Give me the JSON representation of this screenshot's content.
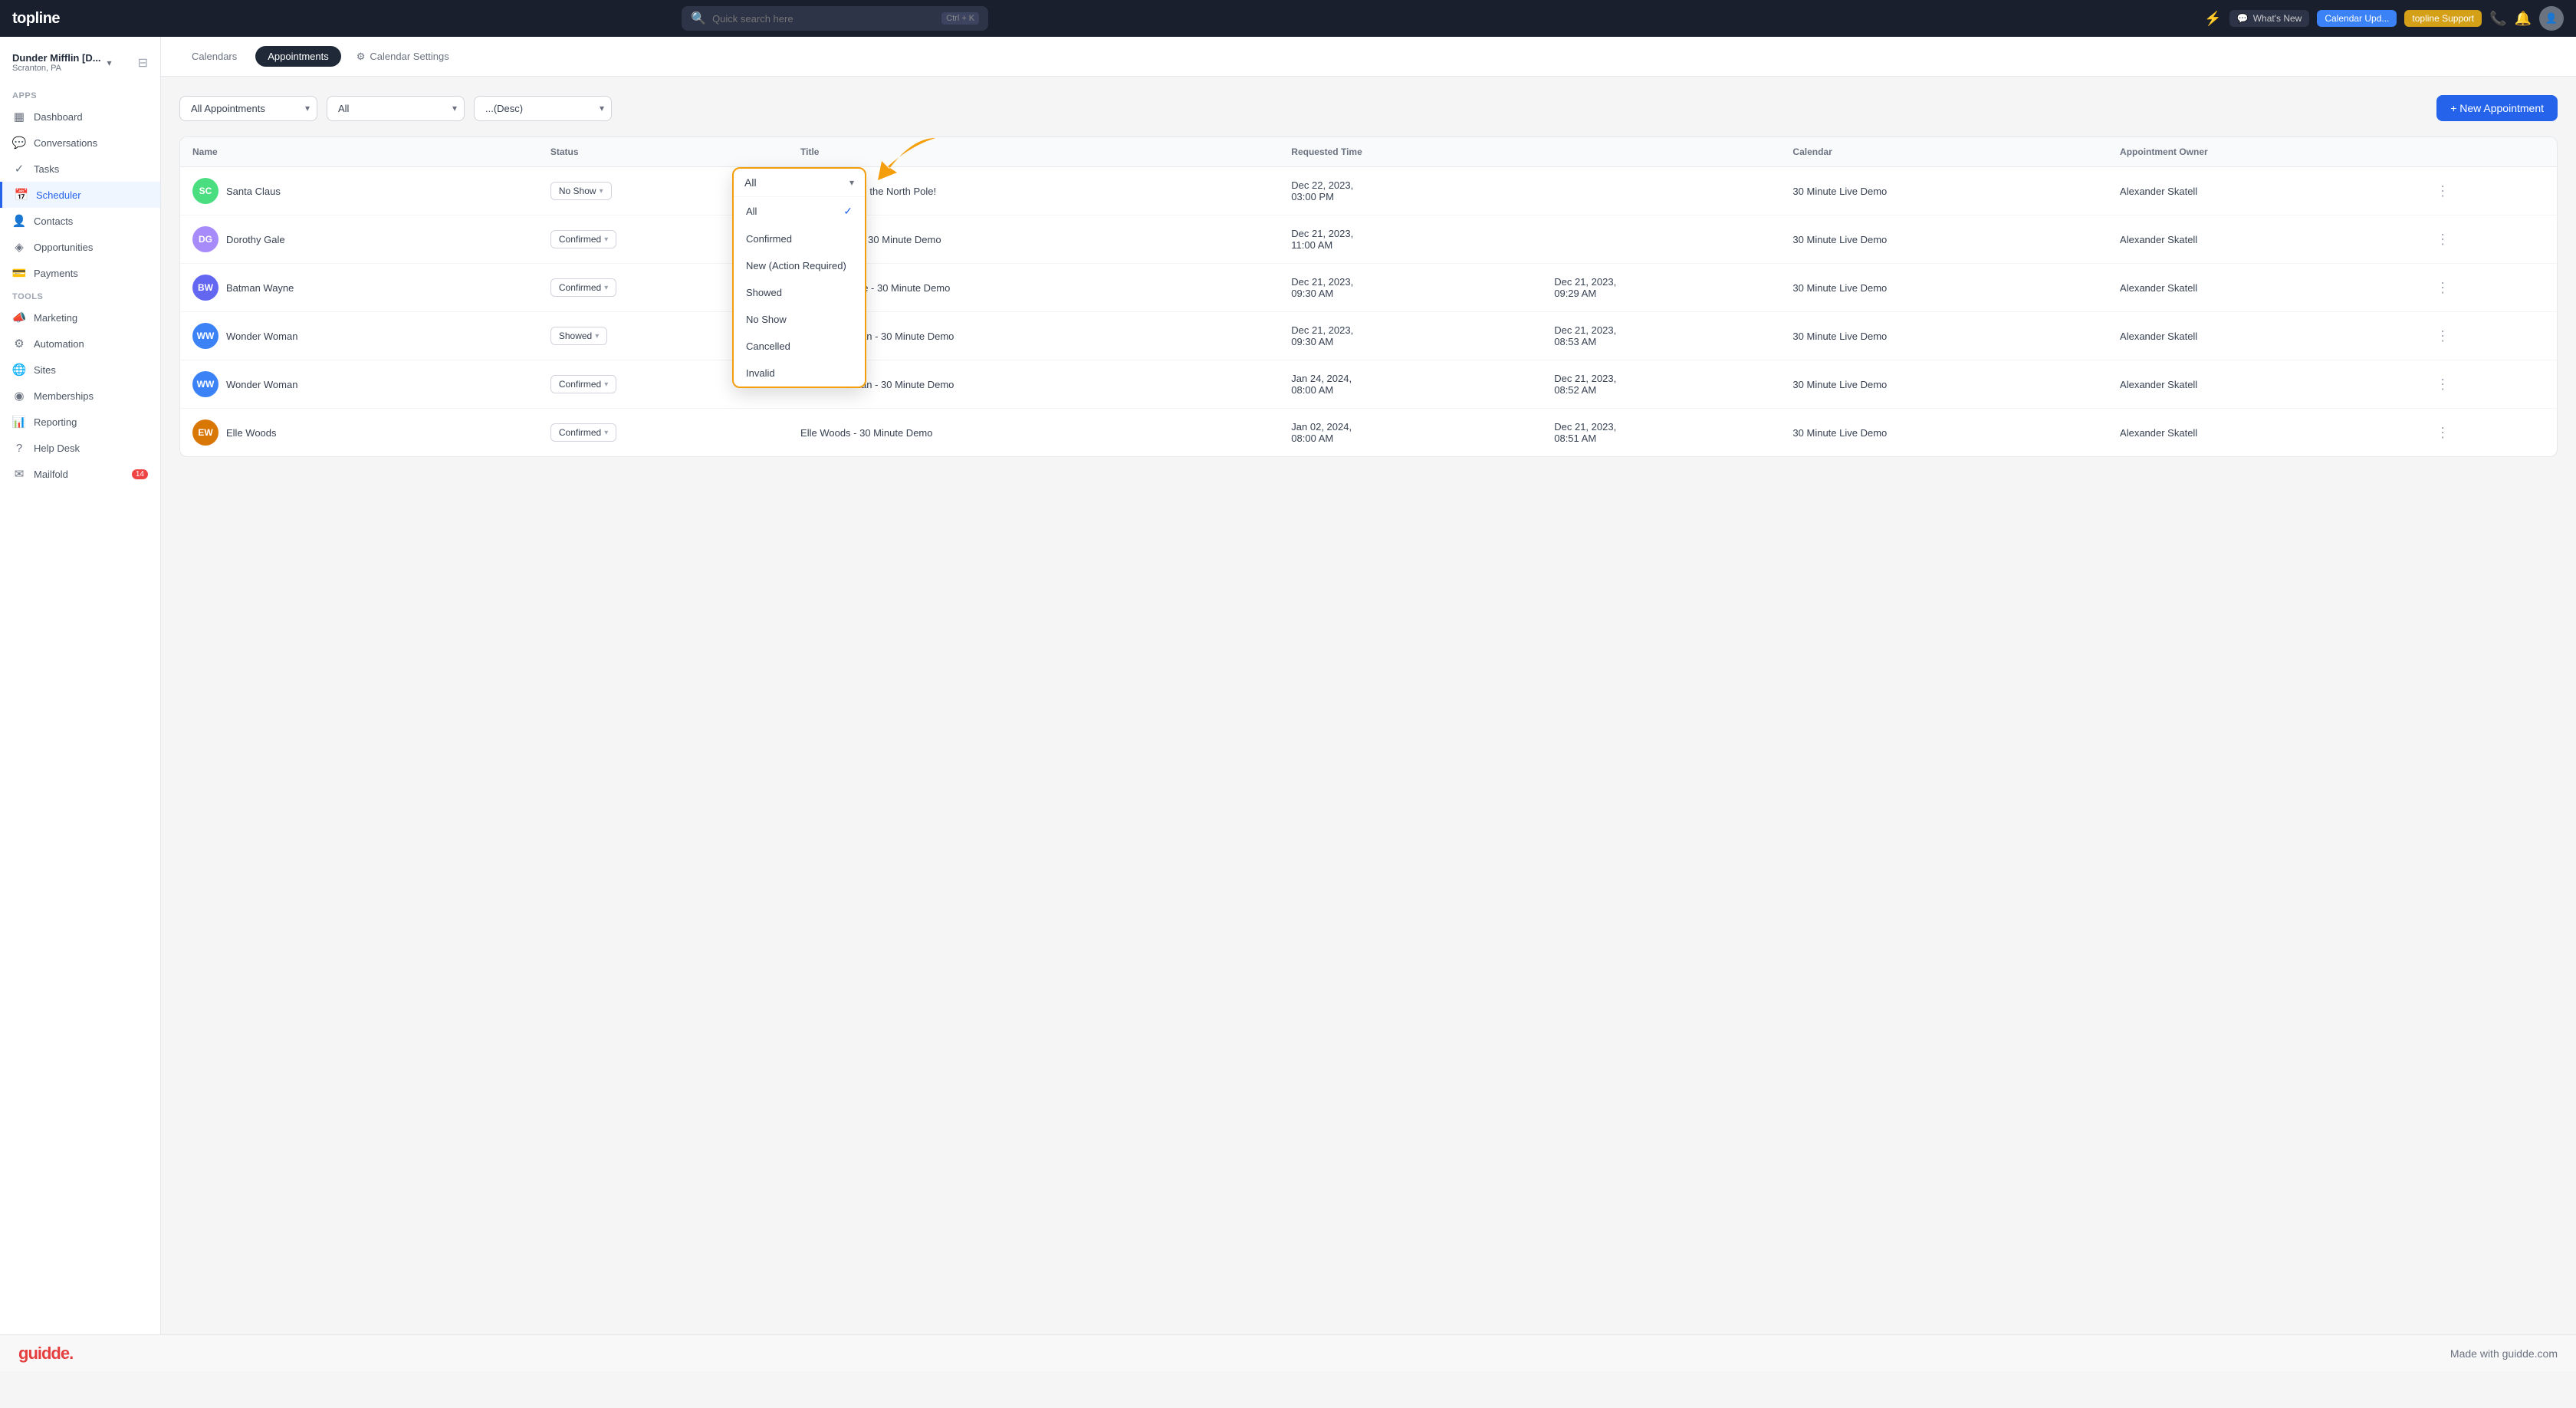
{
  "app": {
    "logo": "topline",
    "search_placeholder": "Quick search here",
    "search_shortcut": "Ctrl + K"
  },
  "topbar": {
    "whats_new": "What's New",
    "calendar_update": "Calendar Upd...",
    "support": "topline Support",
    "lightning_icon": "⚡"
  },
  "sidebar": {
    "company_name": "Dunder Mifflin [D...",
    "company_location": "Scranton, PA",
    "apps_label": "Apps",
    "tools_label": "Tools",
    "items": [
      {
        "id": "dashboard",
        "label": "Dashboard",
        "icon": "▦",
        "active": false
      },
      {
        "id": "conversations",
        "label": "Conversations",
        "icon": "💬",
        "active": false
      },
      {
        "id": "tasks",
        "label": "Tasks",
        "icon": "✓",
        "active": false
      },
      {
        "id": "scheduler",
        "label": "Scheduler",
        "icon": "📅",
        "active": true
      },
      {
        "id": "contacts",
        "label": "Contacts",
        "icon": "👤",
        "active": false
      },
      {
        "id": "opportunities",
        "label": "Opportunities",
        "icon": "◈",
        "active": false
      },
      {
        "id": "payments",
        "label": "Payments",
        "icon": "💳",
        "active": false
      },
      {
        "id": "marketing",
        "label": "Marketing",
        "icon": "📣",
        "active": false
      },
      {
        "id": "automation",
        "label": "Automation",
        "icon": "⚙",
        "active": false
      },
      {
        "id": "sites",
        "label": "Sites",
        "icon": "🌐",
        "active": false
      },
      {
        "id": "memberships",
        "label": "Memberships",
        "icon": "◉",
        "active": false
      },
      {
        "id": "reporting",
        "label": "Reporting",
        "icon": "📊",
        "active": false
      },
      {
        "id": "helpdesk",
        "label": "Help Desk",
        "icon": "?",
        "active": false
      },
      {
        "id": "mailfold",
        "label": "Mailfold",
        "icon": "✉",
        "active": false,
        "badge": "14"
      }
    ]
  },
  "tabs": {
    "calendars": "Calendars",
    "appointments": "Appointments",
    "calendar_settings": "Calendar Settings"
  },
  "filter_bar": {
    "all_appointments_label": "All Appointments",
    "status_filter_label": "All",
    "sort_label": "...(Desc)",
    "new_appointment": "+ New Appointment"
  },
  "status_dropdown": {
    "header_value": "All",
    "items": [
      {
        "id": "all",
        "label": "All",
        "selected": true
      },
      {
        "id": "confirmed",
        "label": "Confirmed",
        "selected": false
      },
      {
        "id": "new_action",
        "label": "New (Action Required)",
        "selected": false
      },
      {
        "id": "showed",
        "label": "Showed",
        "selected": false
      },
      {
        "id": "no_show",
        "label": "No Show",
        "selected": false
      },
      {
        "id": "cancelled",
        "label": "Cancelled",
        "selected": false
      },
      {
        "id": "invalid",
        "label": "Invalid",
        "selected": false
      }
    ]
  },
  "table": {
    "headers": [
      "Name",
      "Status",
      "Title",
      "Requested Time",
      "",
      "Calendar",
      "Appointment Owner",
      ""
    ],
    "rows": [
      {
        "id": "santa",
        "initials": "SC",
        "avatar_color": "#4ade80",
        "name": "Santa Claus",
        "status": "No Show",
        "title": "Appointment in the North Pole!",
        "requested_time": "Dec 22, 2023, 03:00 PM",
        "updated_time": "",
        "calendar": "30 Minute Live Demo",
        "owner": "Alexander Skatell"
      },
      {
        "id": "dorothy",
        "initials": "DG",
        "avatar_color": "#a78bfa",
        "name": "Dorothy Gale",
        "status": "Confirmed",
        "title": "Dorothy Gale - 30 Minute Demo",
        "requested_time": "Dec 21, 2023, 11:00 AM",
        "updated_time": "",
        "calendar": "30 Minute Live Demo",
        "owner": "Alexander Skatell"
      },
      {
        "id": "batman",
        "initials": "BW",
        "avatar_color": "#6366f1",
        "name": "Batman Wayne",
        "status": "Confirmed",
        "title": "Batman Wayne - 30 Minute Demo",
        "requested_time": "Dec 21, 2023, 09:30 AM",
        "updated_time": "Dec 21, 2023, 09:29 AM",
        "calendar": "30 Minute Live Demo",
        "owner": "Alexander Skatell"
      },
      {
        "id": "wonder1",
        "initials": "WW",
        "avatar_color": "#3b82f6",
        "name": "Wonder Woman",
        "status": "Showed",
        "title": "Wonder Woman - 30 Minute Demo",
        "requested_time": "Dec 21, 2023, 09:30 AM",
        "updated_time": "Dec 21, 2023, 08:53 AM",
        "calendar": "30 Minute Live Demo",
        "owner": "Alexander Skatell"
      },
      {
        "id": "wonder2",
        "initials": "WW",
        "avatar_color": "#3b82f6",
        "name": "Wonder Woman",
        "status": "Confirmed",
        "title": "Wonder Woman - 30 Minute Demo",
        "requested_time": "Jan 24, 2024, 08:00 AM",
        "updated_time": "Dec 21, 2023, 08:52 AM",
        "calendar": "30 Minute Live Demo",
        "owner": "Alexander Skatell"
      },
      {
        "id": "elle",
        "initials": "EW",
        "avatar_color": "#d97706",
        "name": "Elle Woods",
        "status": "Confirmed",
        "title": "Elle Woods - 30 Minute Demo",
        "requested_time": "Jan 02, 2024, 08:00 AM",
        "updated_time": "Dec 21, 2023, 08:51 AM",
        "calendar": "30 Minute Live Demo",
        "owner": "Alexander Skatell"
      }
    ]
  },
  "footer": {
    "logo": "guidde.",
    "text": "Made with guidde.com"
  }
}
